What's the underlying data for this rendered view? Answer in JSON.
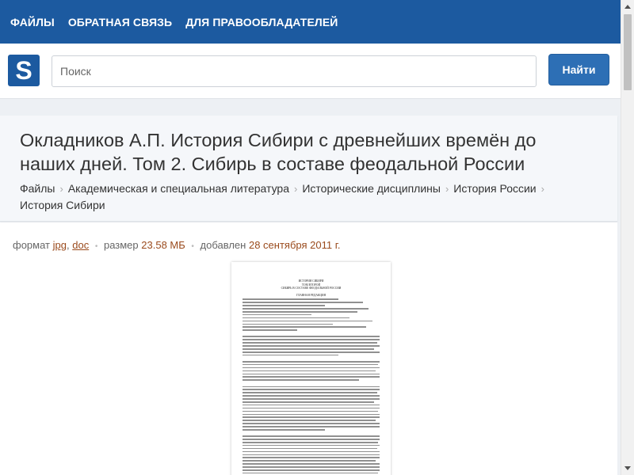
{
  "nav": {
    "items": [
      "ФАЙЛЫ",
      "ОБРАТНАЯ СВЯЗЬ",
      "ДЛЯ ПРАВООБЛАДАТЕЛЕЙ"
    ]
  },
  "logo": {
    "letter": "S"
  },
  "search": {
    "placeholder": "Поиск",
    "button_label": "Найти"
  },
  "page": {
    "title": "Окладников А.П. История Сибири с древнейших времён до наших дней. Том 2. Сибирь в составе феодальной России",
    "breadcrumbs": [
      "Файлы",
      "Академическая и специальная литература",
      "Исторические дисциплины",
      "История России",
      "История Сибири"
    ]
  },
  "meta": {
    "format_label": "формат",
    "format_jpg": "jpg",
    "format_sep": ",",
    "format_doc": "doc",
    "size_label": "размер",
    "size_value": "23.58 МБ",
    "added_label": "добавлен",
    "added_value": "28 сентября 2011 г."
  },
  "preview": {
    "head_1": "ИСТОРИЯ СИБИРИ",
    "head_2": "ТОМ ВТОРОЙ",
    "head_3": "СИБИРЬ В СОСТАВЕ ФЕОДАЛЬНОЙ РОССИИ",
    "head_4": "ГЛАВНАЯ РЕДАКЦИЯ"
  },
  "colors": {
    "nav_bg": "#1c5aa0",
    "button_bg": "#2d6fb5",
    "meta_value": "#9a4a1c"
  }
}
